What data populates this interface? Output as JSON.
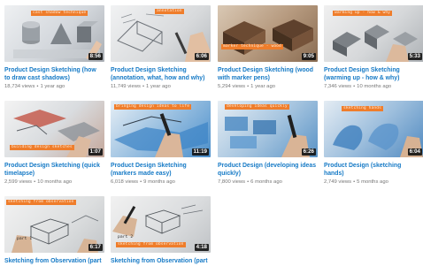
{
  "videos": [
    {
      "overlay_tags": [
        "cast shadow technique"
      ],
      "duration": "8:56",
      "title_line1": "Product Design Sketching (how",
      "title_line2": "to draw cast shadows)",
      "views": "18,734 views",
      "age": "1 year ago"
    },
    {
      "overlay_tags": [
        "annotation"
      ],
      "duration": "6:06",
      "title_line1": "Product Design Sketching",
      "title_line2": "(annotation, what, how and why)",
      "views": "11,749 views",
      "age": "1 year ago"
    },
    {
      "overlay_tags": [
        "marker technique - wood"
      ],
      "duration": "9:05",
      "title_line1": "Product Design Sketching (wood",
      "title_line2": "with marker pens)",
      "views": "5,294 views",
      "age": "1 year ago"
    },
    {
      "overlay_tags": [
        "warming up - how & why"
      ],
      "duration": "5:33",
      "title_line1": "Product Design Sketching",
      "title_line2": "(warming up - how & why)",
      "views": "7,346 views",
      "age": "10 months ago"
    },
    {
      "overlay_tags": [
        "building design sketches"
      ],
      "duration": "1:07",
      "title_line1": "Product Design Sketching (quick",
      "title_line2": "timelapse)",
      "views": "2,599 views",
      "age": "10 months ago"
    },
    {
      "overlay_tags": [
        "bringing design ideas to life"
      ],
      "duration": "11:19",
      "title_line1": "Product Design Sketching",
      "title_line2": "(markers made easy)",
      "views": "6,018 views",
      "age": "9 months ago"
    },
    {
      "overlay_tags": [
        "developing ideas quickly"
      ],
      "duration": "6:26",
      "title_line1": "Product Design (developing ideas",
      "title_line2": "quickly)",
      "views": "7,800 views",
      "age": "6 months ago"
    },
    {
      "overlay_tags": [
        "sketching hands"
      ],
      "duration": "6:04",
      "title_line1": "Product Design (sketching",
      "title_line2": "hands)",
      "views": "2,749 views",
      "age": "5 months ago"
    },
    {
      "overlay_tags": [
        "sketching from observation",
        "part 1"
      ],
      "duration": "6:17",
      "title_line1": "Sketching from Observation (part",
      "title_line2": "",
      "views": "",
      "age": ""
    },
    {
      "overlay_tags": [
        "part 2",
        "sketching from observation"
      ],
      "duration": "4:18",
      "title_line1": "Sketching from Observation (part",
      "title_line2": "",
      "views": "",
      "age": ""
    }
  ],
  "colors": {
    "title_link": "#167ac6",
    "meta_text": "#767676",
    "overlay_tag_bg": "#ef7d2b",
    "duration_bg": "#111111"
  },
  "icons": [
    "video-thumbnail"
  ]
}
